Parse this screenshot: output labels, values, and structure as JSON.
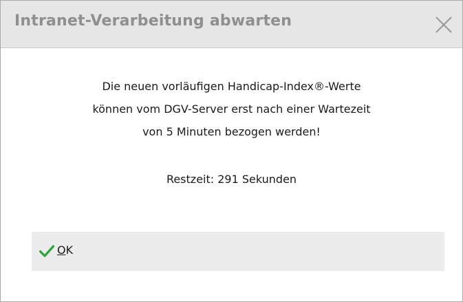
{
  "window": {
    "title": "Intranet-Verarbeitung abwarten",
    "close_icon": "close-icon"
  },
  "message": {
    "lines": [
      "Die neuen vorläufigen Handicap-Index®-Werte",
      "können vom DGV-Server erst nach einer Wartezeit",
      "von 5 Minuten bezogen werden!"
    ]
  },
  "countdown": {
    "text": "Restzeit: 291 Sekunden"
  },
  "ok_button": {
    "mnemonic": "O",
    "rest": "K",
    "icon": "checkmark-icon",
    "icon_color": "#2aa63a"
  },
  "colors": {
    "titlebar_bg": "#e6e6e6",
    "title_text": "#8f8f8f",
    "button_bg": "#ececec"
  }
}
